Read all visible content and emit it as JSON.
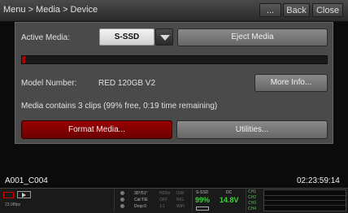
{
  "title_bar": {
    "path": "Menu > Media > Device",
    "more_label": "...",
    "back_label": "Back",
    "close_label": "Close"
  },
  "dialog": {
    "active_media_label": "Active Media:",
    "active_media_value": "S-SSD",
    "eject_label": "Eject Media",
    "usage_percent": 1,
    "model_label": "Model Number:",
    "model_value": "RED 120GB V2",
    "more_info_label": "More Info...",
    "media_info": "Media contains 3 clips (99% free, 0:19 time remaining)",
    "format_label": "Format Media...",
    "utilities_label": "Utilities..."
  },
  "overlay": {
    "clip_name": "A001_C004",
    "timecode": "02:23:59:14"
  },
  "status_bar": {
    "fps": "23.98fps",
    "shutter": "30°/51°",
    "cal": "Cal:T/E",
    "drop": "Drop:0",
    "hdrx": "HDRx",
    "hdrx_state": "OFF",
    "ratio": "1:1",
    "ism": "ISM",
    "rig": "RIG",
    "wifi": "WiFi",
    "media_name": "S-SSD",
    "media_percent": "99%",
    "power_name": "DC",
    "voltage": "14.8V",
    "channels": [
      "CH1",
      "CH2",
      "CH3",
      "CH4"
    ],
    "accent_green": "#3bd43b",
    "accent_red": "#b00000"
  }
}
